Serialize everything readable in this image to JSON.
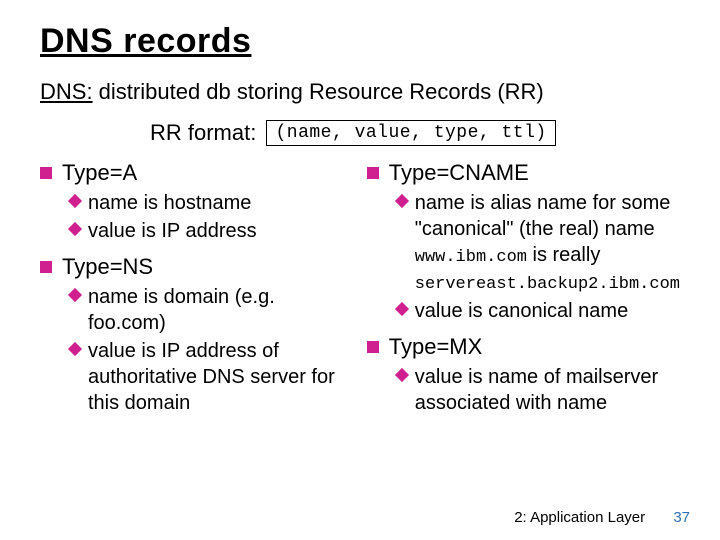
{
  "title": "DNS records",
  "subtitle_u": "DNS:",
  "subtitle_rest": " distributed db storing Resource Records (RR)",
  "format_label": "RR format: ",
  "format_tuple": "(name, value, type, ttl)",
  "left": {
    "sec1": {
      "heading": "Type=A",
      "items": [
        "name is hostname",
        "value is IP address"
      ]
    },
    "sec2": {
      "heading": "Type=NS",
      "items": [
        "name is domain (e.g. foo.com)",
        "value is IP address of authoritative DNS server for this domain"
      ]
    }
  },
  "right": {
    "sec1": {
      "heading": "Type=CNAME",
      "item1_a": "name is alias name for some \"canonical\" (the real) name",
      "item1_mono1": "www.ibm.com",
      "item1_b": " is really ",
      "item1_mono2": "servereast.backup2.ibm.com",
      "item2": "value is canonical name"
    },
    "sec2": {
      "heading": "Type=MX",
      "items": [
        "value is name of mailserver associated with name"
      ]
    }
  },
  "footer_label": "2: Application Layer",
  "page_number": "37"
}
